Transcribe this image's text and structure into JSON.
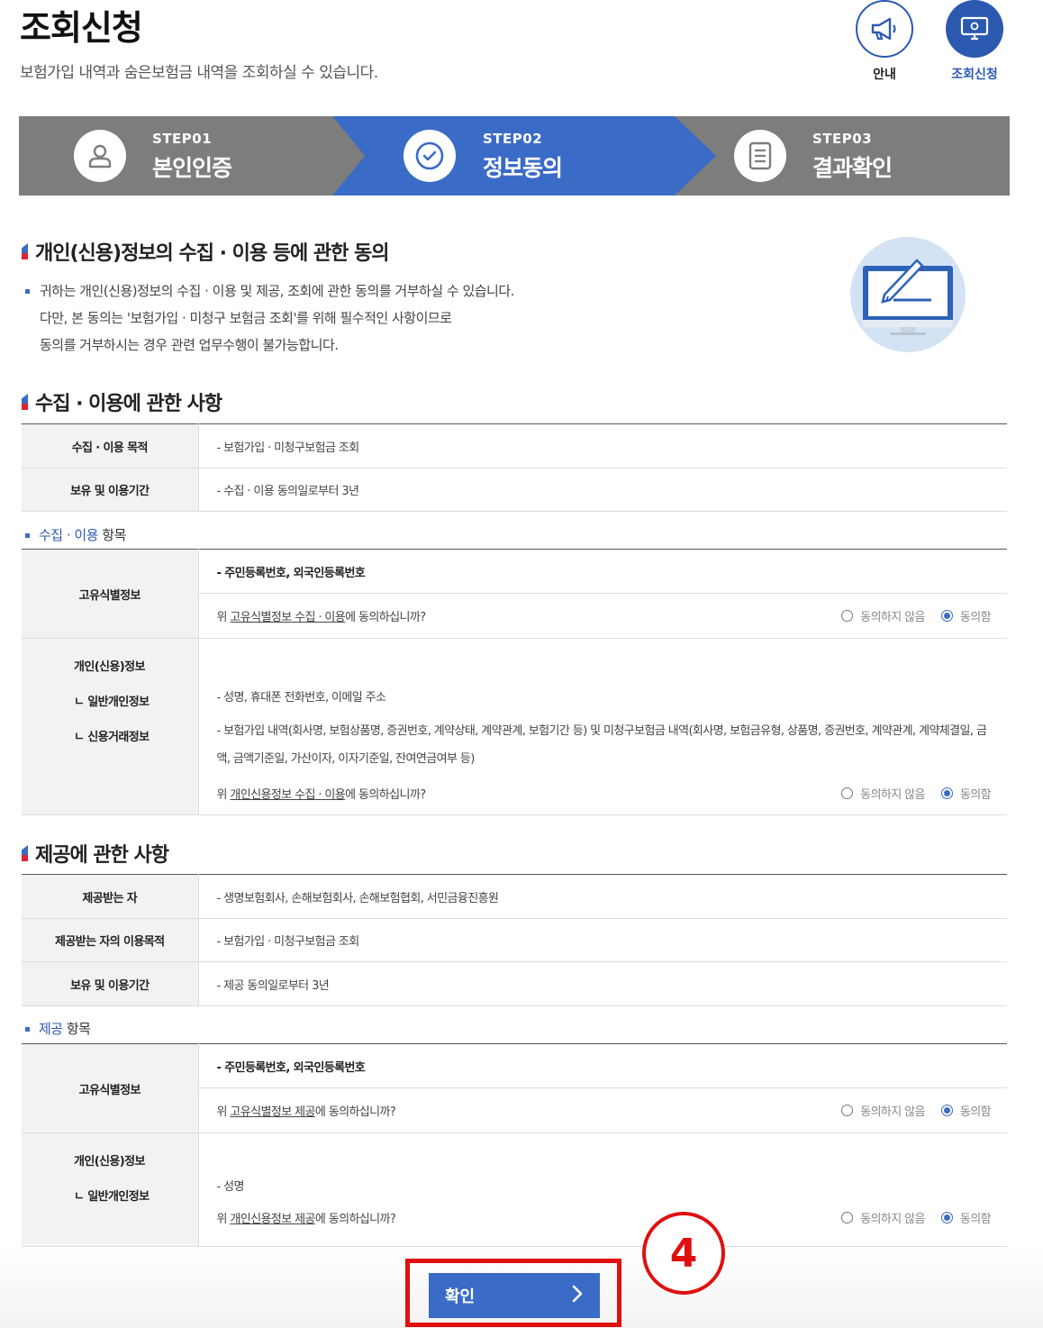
{
  "header": {
    "title": "조회신청",
    "subtitle": "보험가입 내역과 숨은보험금 내역을 조회하실 수 있습니다.",
    "guide_label": "안내",
    "apply_label": "조회신청"
  },
  "steps": [
    {
      "num": "STEP01",
      "name": "본인인증"
    },
    {
      "num": "STEP02",
      "name": "정보동의"
    },
    {
      "num": "STEP03",
      "name": "결과확인"
    }
  ],
  "consent_section": {
    "title": "개인(신용)정보의 수집 · 이용 등에 관한 동의",
    "lines": [
      "귀하는 개인(신용)정보의 수집 · 이용 및 제공, 조회에 관한 동의를 거부하실 수 있습니다.",
      "다만, 본 동의는 '보험가입 · 미청구 보험금 조회'를 위해 필수적인 사항이므로",
      "동의를 거부하시는 경우 관련 업무수행이 불가능합니다."
    ]
  },
  "collect_section": {
    "title": "수집 · 이용에 관한 사항",
    "rows": [
      {
        "label": "수집 · 이용 목적",
        "value": "- 보험가입 · 미청구보험금 조회"
      },
      {
        "label": "보유 및 이용기간",
        "value": "- 수집 · 이용 동의일로부터 3년"
      }
    ],
    "items_head_blue": "수집 · 이용",
    "items_head_rest": " 항목",
    "unique": {
      "label": "고유식별정보",
      "value": "- 주민등록번호, 외국인등록번호",
      "q_pre": "위 ",
      "q_link": "고유식별정보 수집 · 이용",
      "q_post": "에 동의하십니까?"
    },
    "personal": {
      "label1": "개인(신용)정보",
      "label2": "ㄴ 일반개인정보",
      "label3": "ㄴ 신용거래정보",
      "general": "- 성명, 휴대폰 전화번호, 이메일 주소",
      "credit1": "- 보험가입 내역(회사명, 보험상품명, 증권번호, 계약상태, 계약관계, 보험기간 등) 및 미청구보험금 내역(회사명, 보험금유형, 상품명, 증권번호, 계약관계, 계약체결일, 금",
      "credit2": "액, 금액기준일, 가산이자, 이자기준일, 잔여연금여부 등)",
      "q_pre": "위 ",
      "q_link": "개인신용정보 수집 · 이용",
      "q_post": "에 동의하십니까?"
    }
  },
  "provide_section": {
    "title": "제공에 관한 사항",
    "rows": [
      {
        "label": "제공받는 자",
        "value": "- 생명보험회사, 손해보험회사, 손해보험협회, 서민금융진흥원"
      },
      {
        "label": "제공받는 자의 이용목적",
        "value": "- 보험가입 · 미청구보험금 조회"
      },
      {
        "label": "보유 및 이용기간",
        "value": "- 제공 동의일로부터 3년"
      }
    ],
    "items_head_blue": "제공",
    "items_head_rest": " 항목",
    "unique": {
      "label": "고유식별정보",
      "value": "- 주민등록번호, 외국인등록번호",
      "q_pre": "위 ",
      "q_link": "고유식별정보 제공",
      "q_post": "에 동의하십니까?"
    },
    "personal": {
      "label1": "개인(신용)정보",
      "label2": "ㄴ 일반개인정보",
      "general": "- 성명",
      "q_pre": "위 ",
      "q_link": "개인신용정보 제공",
      "q_post": "에 동의하십니까?"
    }
  },
  "radio": {
    "disagree": "동의하지 않음",
    "agree": "동의함",
    "selected": "agree"
  },
  "confirm": {
    "label": "확인",
    "arrow": "›"
  },
  "annotation": {
    "number": "4",
    "color": "#e01010"
  },
  "colors": {
    "primary": "#3a6bc6",
    "step_inactive": "#7d7d7d"
  }
}
